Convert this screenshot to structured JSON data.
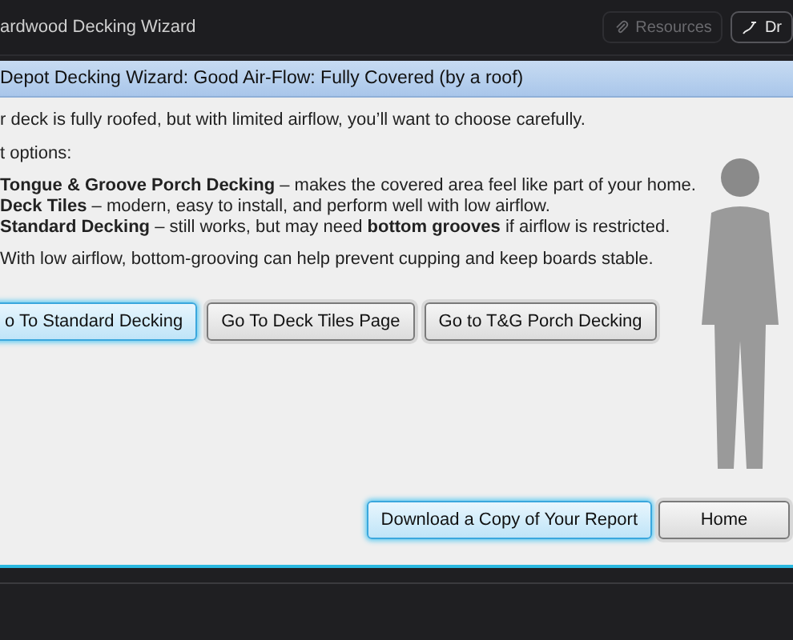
{
  "window": {
    "title": "ardwood Decking Wizard"
  },
  "toolbar": [
    {
      "label": "Resources",
      "kind": "attach",
      "disabled": true
    },
    {
      "label": "Dr",
      "kind": "draw",
      "disabled": false
    }
  ],
  "header": {
    "title": "Depot Decking Wizard: Good Air-Flow: Fully Covered (by a roof)"
  },
  "intro": "r deck is fully roofed, but with limited airflow, you’ll want to choose carefully.",
  "options_heading": "t options:",
  "options": [
    "**Tongue & Groove Porch Decking** – makes the covered area feel like part of your home.",
    "**Deck Tiles** – modern, easy to install, and perform well with low airflow.",
    "**Standard Decking** – still works, but may need **bottom grooves** if airflow is restricted."
  ],
  "note": "With low airflow, bottom-grooving can help prevent cupping and keep boards stable.",
  "nav_buttons": [
    {
      "label": "o To Standard Decking",
      "highlighted": true
    },
    {
      "label": "Go To Deck Tiles Page",
      "highlighted": false
    },
    {
      "label": "Go to T&G Porch Decking",
      "highlighted": false
    }
  ],
  "footer_buttons": [
    {
      "label": "Download a Copy of Your Report",
      "highlighted": true
    },
    {
      "label": "Home",
      "highlighted": false
    }
  ]
}
